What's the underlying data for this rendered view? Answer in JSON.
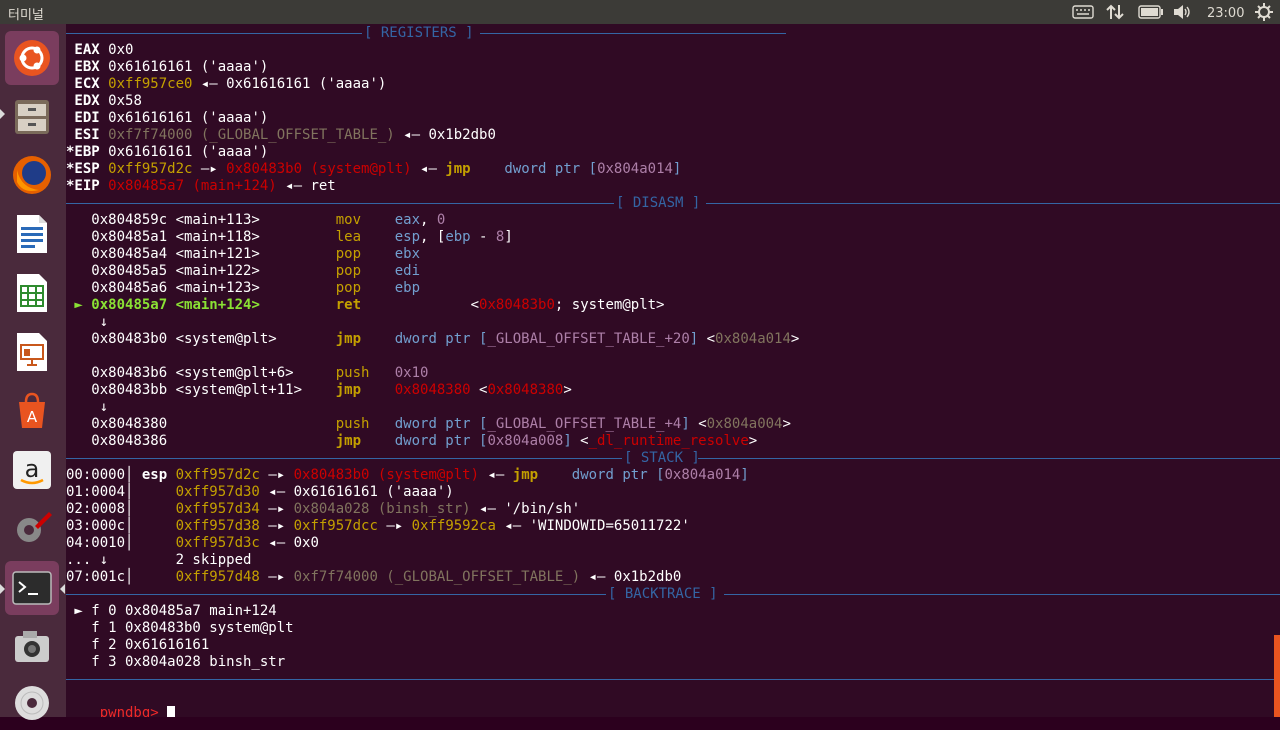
{
  "app_title": "터미널",
  "indicators": {
    "clock": "23:00"
  },
  "launcher": [
    "ubuntu-dash-icon",
    "files-icon",
    "firefox-icon",
    "writer-icon",
    "calc-icon",
    "impress-icon",
    "software-center-icon",
    "amazon-icon",
    "system-settings-icon",
    "terminal-icon",
    "camera-icon",
    "dvd-icon"
  ],
  "headers": {
    "registers": "[ REGISTERS ]",
    "disasm": "[ DISASM ]",
    "stack": "[ STACK ]",
    "backtrace": "[ BACKTRACE ]"
  },
  "registers": [
    {
      "name": " EAX ",
      "parts": [
        [
          "0x0",
          ""
        ]
      ]
    },
    {
      "name": " EBX ",
      "parts": [
        [
          "0x61616161 ('aaaa')",
          ""
        ]
      ]
    },
    {
      "name": " ECX ",
      "parts": [
        [
          "0xff957ce0",
          "y"
        ],
        [
          " ◂— 0x61616161 ('aaaa')",
          ""
        ]
      ]
    },
    {
      "name": " EDX ",
      "parts": [
        [
          "0x58",
          ""
        ]
      ]
    },
    {
      "name": " EDI ",
      "parts": [
        [
          "0x61616161 ('aaaa')",
          ""
        ]
      ]
    },
    {
      "name": " ESI ",
      "parts": [
        [
          "0xf7f74000 (_GLOBAL_OFFSET_TABLE_)",
          "gy"
        ],
        [
          " ◂— 0x1b2db0",
          ""
        ]
      ]
    },
    {
      "name": "*EBP ",
      "parts": [
        [
          "0x61616161 ('aaaa')",
          ""
        ]
      ]
    },
    {
      "name": "*ESP ",
      "parts": [
        [
          "0xff957d2c",
          "y"
        ],
        [
          " —▸ ",
          ""
        ],
        [
          "0x80483b0 (system@plt)",
          "r"
        ],
        [
          " ◂— ",
          ""
        ],
        [
          "jmp",
          "jm"
        ],
        [
          "    ",
          ""
        ],
        [
          "dword ptr [",
          "bl"
        ],
        [
          "0x804a014",
          "pu"
        ],
        [
          "]",
          "bl"
        ]
      ]
    },
    {
      "name": "*EIP ",
      "parts": [
        [
          "0x80485a7 (main+124)",
          "r"
        ],
        [
          " ◂— ret",
          ""
        ]
      ]
    }
  ],
  "disasm": [
    {
      "parts": [
        [
          "   0x804859c <main+113>         ",
          ""
        ],
        [
          "mov",
          "mo"
        ],
        [
          "    ",
          ""
        ],
        [
          "eax",
          "bl"
        ],
        [
          ", ",
          ""
        ],
        [
          "0",
          "pu"
        ]
      ]
    },
    {
      "parts": [
        [
          "   0x80485a1 <main+118>         ",
          ""
        ],
        [
          "lea",
          "mo"
        ],
        [
          "    ",
          ""
        ],
        [
          "esp",
          "bl"
        ],
        [
          ", [",
          ""
        ],
        [
          "ebp",
          "bl"
        ],
        [
          " - ",
          ""
        ],
        [
          "8",
          "pu"
        ],
        [
          "]",
          ""
        ]
      ]
    },
    {
      "parts": [
        [
          "   0x80485a4 <main+121>         ",
          ""
        ],
        [
          "pop",
          "mo"
        ],
        [
          "    ",
          ""
        ],
        [
          "ebx",
          "bl"
        ]
      ]
    },
    {
      "parts": [
        [
          "   0x80485a5 <main+122>         ",
          ""
        ],
        [
          "pop",
          "mo"
        ],
        [
          "    ",
          ""
        ],
        [
          "edi",
          "bl"
        ]
      ]
    },
    {
      "parts": [
        [
          "   0x80485a6 <main+123>         ",
          ""
        ],
        [
          "pop",
          "mo"
        ],
        [
          "    ",
          ""
        ],
        [
          "ebp",
          "bl"
        ]
      ]
    },
    {
      "parts": [
        [
          " ► ",
          "g"
        ],
        [
          "0x80485a7 <main+124>",
          "g"
        ],
        [
          "         ",
          ""
        ],
        [
          "ret",
          "jm"
        ],
        [
          "             <",
          ""
        ],
        [
          "0x80483b0",
          "r"
        ],
        [
          "; system@plt>",
          ""
        ]
      ]
    },
    {
      "parts": [
        [
          "    ↓",
          ""
        ]
      ]
    },
    {
      "parts": [
        [
          "   0x80483b0 <system@plt>       ",
          ""
        ],
        [
          "jmp",
          "jm"
        ],
        [
          "    ",
          ""
        ],
        [
          "dword ptr [",
          "bl"
        ],
        [
          "_GLOBAL_OFFSET_TABLE_+20",
          "pu"
        ],
        [
          "]",
          "bl"
        ],
        [
          " <",
          ""
        ],
        [
          "0x804a014",
          "gy"
        ],
        [
          ">",
          ""
        ]
      ]
    },
    {
      "parts": [
        [
          "",
          ""
        ]
      ]
    },
    {
      "parts": [
        [
          "   0x80483b6 <system@plt+6>     ",
          ""
        ],
        [
          "push",
          "mo"
        ],
        [
          "   ",
          ""
        ],
        [
          "0x10",
          "pu"
        ]
      ]
    },
    {
      "parts": [
        [
          "   0x80483bb <system@plt+11>    ",
          ""
        ],
        [
          "jmp",
          "jm"
        ],
        [
          "    ",
          ""
        ],
        [
          "0x8048380",
          "r"
        ],
        [
          " <",
          ""
        ],
        [
          "0x8048380",
          "r"
        ],
        [
          ">",
          ""
        ]
      ]
    },
    {
      "parts": [
        [
          "    ↓",
          ""
        ]
      ]
    },
    {
      "parts": [
        [
          "   0x8048380                    ",
          ""
        ],
        [
          "push",
          "mo"
        ],
        [
          "   ",
          ""
        ],
        [
          "dword ptr [",
          "bl"
        ],
        [
          "_GLOBAL_OFFSET_TABLE_+4",
          "pu"
        ],
        [
          "]",
          "bl"
        ],
        [
          " <",
          ""
        ],
        [
          "0x804a004",
          "gy"
        ],
        [
          ">",
          ""
        ]
      ]
    },
    {
      "parts": [
        [
          "   0x8048386                    ",
          ""
        ],
        [
          "jmp",
          "jm"
        ],
        [
          "    ",
          ""
        ],
        [
          "dword ptr [",
          "bl"
        ],
        [
          "0x804a008",
          "pu"
        ],
        [
          "]",
          "bl"
        ],
        [
          " <",
          ""
        ],
        [
          "_dl_runtime_resolve",
          "r"
        ],
        [
          ">",
          ""
        ]
      ]
    }
  ],
  "stack": [
    {
      "parts": [
        [
          "00:0000│ ",
          ""
        ],
        [
          "esp",
          "b"
        ],
        [
          " ",
          ""
        ],
        [
          "0xff957d2c",
          "y"
        ],
        [
          " —▸ ",
          ""
        ],
        [
          "0x80483b0 (system@plt)",
          "r"
        ],
        [
          " ◂— ",
          ""
        ],
        [
          "jmp",
          "jm"
        ],
        [
          "    ",
          ""
        ],
        [
          "dword ptr [",
          "bl"
        ],
        [
          "0x804a014",
          "pu"
        ],
        [
          "]",
          "bl"
        ]
      ]
    },
    {
      "parts": [
        [
          "01:0004│     ",
          ""
        ],
        [
          "0xff957d30",
          "y"
        ],
        [
          " ◂— 0x61616161 ('aaaa')",
          ""
        ]
      ]
    },
    {
      "parts": [
        [
          "02:0008│     ",
          ""
        ],
        [
          "0xff957d34",
          "y"
        ],
        [
          " —▸ ",
          ""
        ],
        [
          "0x804a028 (binsh_str)",
          "gy"
        ],
        [
          " ◂— '/bin/sh'",
          ""
        ]
      ]
    },
    {
      "parts": [
        [
          "03:000c│     ",
          ""
        ],
        [
          "0xff957d38",
          "y"
        ],
        [
          " —▸ ",
          ""
        ],
        [
          "0xff957dcc",
          "y"
        ],
        [
          " —▸ ",
          ""
        ],
        [
          "0xff9592ca",
          "y"
        ],
        [
          " ◂— 'WINDOWID=65011722'",
          ""
        ]
      ]
    },
    {
      "parts": [
        [
          "04:0010│     ",
          ""
        ],
        [
          "0xff957d3c",
          "y"
        ],
        [
          " ◂— 0x0",
          ""
        ]
      ]
    },
    {
      "parts": [
        [
          "... ↓        2 skipped",
          ""
        ]
      ]
    },
    {
      "parts": [
        [
          "07:001c│     ",
          ""
        ],
        [
          "0xff957d48",
          "y"
        ],
        [
          " —▸ ",
          ""
        ],
        [
          "0xf7f74000 (_GLOBAL_OFFSET_TABLE_)",
          "gy"
        ],
        [
          " ◂— 0x1b2db0",
          ""
        ]
      ]
    }
  ],
  "backtrace": [
    {
      "parts": [
        [
          " ► f 0 0x80485a7 main+124",
          ""
        ]
      ]
    },
    {
      "parts": [
        [
          "   f 1 0x80483b0 system@plt",
          ""
        ]
      ]
    },
    {
      "parts": [
        [
          "   f 2 0x61616161",
          ""
        ]
      ]
    },
    {
      "parts": [
        [
          "   f 3 0x804a028 binsh_str",
          ""
        ]
      ]
    }
  ],
  "prompt": "pwndbg> "
}
